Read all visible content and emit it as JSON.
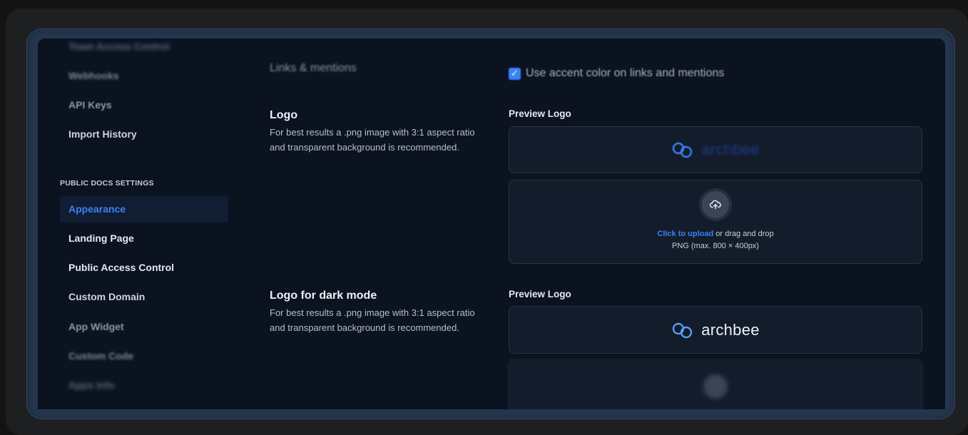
{
  "sidebar": {
    "items_top": [
      {
        "label": "Team Access Control"
      },
      {
        "label": "Webhooks"
      },
      {
        "label": "API Keys"
      },
      {
        "label": "Import History"
      }
    ],
    "section_title": "PUBLIC DOCS SETTINGS",
    "items_public": [
      {
        "label": "Appearance",
        "active": true
      },
      {
        "label": "Landing Page"
      },
      {
        "label": "Public Access Control"
      },
      {
        "label": "Custom Domain"
      },
      {
        "label": "App Widget"
      },
      {
        "label": "Custom Code"
      },
      {
        "label": "Apps Info"
      }
    ]
  },
  "content": {
    "links_heading": "Links & mentions",
    "accent_checkbox": {
      "label": "Use accent color on links and mentions",
      "checked": true
    },
    "logo": {
      "title": "Logo",
      "description": "For best results a .png image with 3:1 aspect ratio and transparent background is recommended.",
      "preview_label": "Preview Logo",
      "brand_text": "archbee",
      "upload_link": "Click to upload",
      "upload_rest": "or drag and drop",
      "upload_hint": "PNG (max. 800 × 400px)"
    },
    "logo_dark": {
      "title": "Logo for dark mode",
      "description": "For best results a .png image with 3:1 aspect ratio and transparent background is recommended.",
      "preview_label": "Preview Logo",
      "brand_text": "archbee"
    }
  },
  "colors": {
    "accent": "#3b82f6",
    "background": "#0b1220",
    "panel": "#131c2b"
  }
}
